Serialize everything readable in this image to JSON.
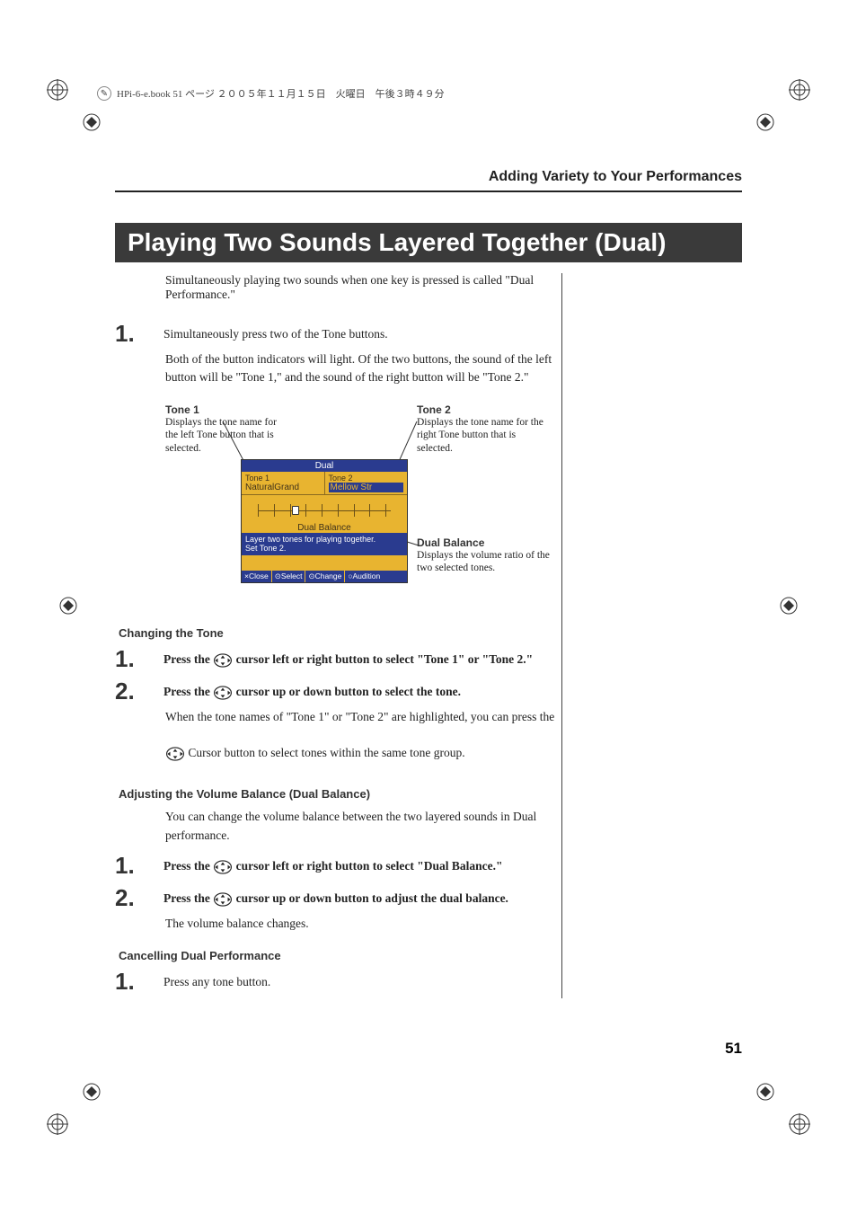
{
  "header": {
    "file_info": "HPi-6-e.book 51 ページ ２００５年１１月１５日　火曜日　午後３時４９分"
  },
  "section_header": "Adding Variety to Your Performances",
  "title": "Playing Two Sounds Layered Together (Dual)",
  "intro": "Simultaneously playing two sounds when one key is pressed is called \"Dual Performance.\"",
  "main_steps": {
    "s1": {
      "num": "1.",
      "instruction": "Simultaneously press two of the Tone buttons.",
      "body": "Both of the button indicators will light. Of the two buttons, the sound of the left button will be \"Tone 1,\" and the sound of the right button will be \"Tone 2.\""
    }
  },
  "diagram": {
    "tone1": {
      "label": "Tone 1",
      "desc": "Displays the tone name for the left Tone button that is selected."
    },
    "tone2": {
      "label": "Tone 2",
      "desc": "Displays the tone name for the right Tone button that is selected."
    },
    "dual_balance": {
      "label": "Dual Balance",
      "desc": "Displays the volume ratio of the two selected tones."
    },
    "lcd": {
      "header": "Dual",
      "t1_label": "Tone 1",
      "t1_val": "NaturalGrand",
      "t2_label": "Tone 2",
      "t2_val": "Mellow Str",
      "slider_label": "Dual Balance",
      "msg_line1": "Layer two tones for playing together.",
      "msg_line2": "Set Tone 2.",
      "footer": {
        "close": "×Close",
        "select": "⊙Select",
        "change": "⊙Change",
        "audition": "○Audition"
      }
    }
  },
  "changing_tone": {
    "heading": "Changing the Tone",
    "s1": {
      "num": "1.",
      "before": "Press the ",
      "after": " cursor left or right button to select \"Tone 1\" or \"Tone 2.\""
    },
    "s2": {
      "num": "2.",
      "before": "Press the ",
      "after": " cursor up or down button to select the tone.",
      "body_before": "When the tone names of \"Tone 1\" or \"Tone 2\" are highlighted, you can press the",
      "body_after": " Cursor button to select tones within the same tone group."
    }
  },
  "adjusting_balance": {
    "heading": "Adjusting the Volume Balance (Dual Balance)",
    "intro": "You can change the volume balance between the two layered sounds in Dual performance.",
    "s1": {
      "num": "1.",
      "before": "Press the ",
      "after": " cursor left or right button to select \"Dual Balance.\""
    },
    "s2": {
      "num": "2.",
      "before": "Press the ",
      "after": " cursor up or down button to adjust the dual balance.",
      "body": "The volume balance changes."
    }
  },
  "cancelling": {
    "heading": "Cancelling Dual Performance",
    "s1": {
      "num": "1.",
      "instruction": "Press any tone button."
    }
  },
  "page_number": "51"
}
